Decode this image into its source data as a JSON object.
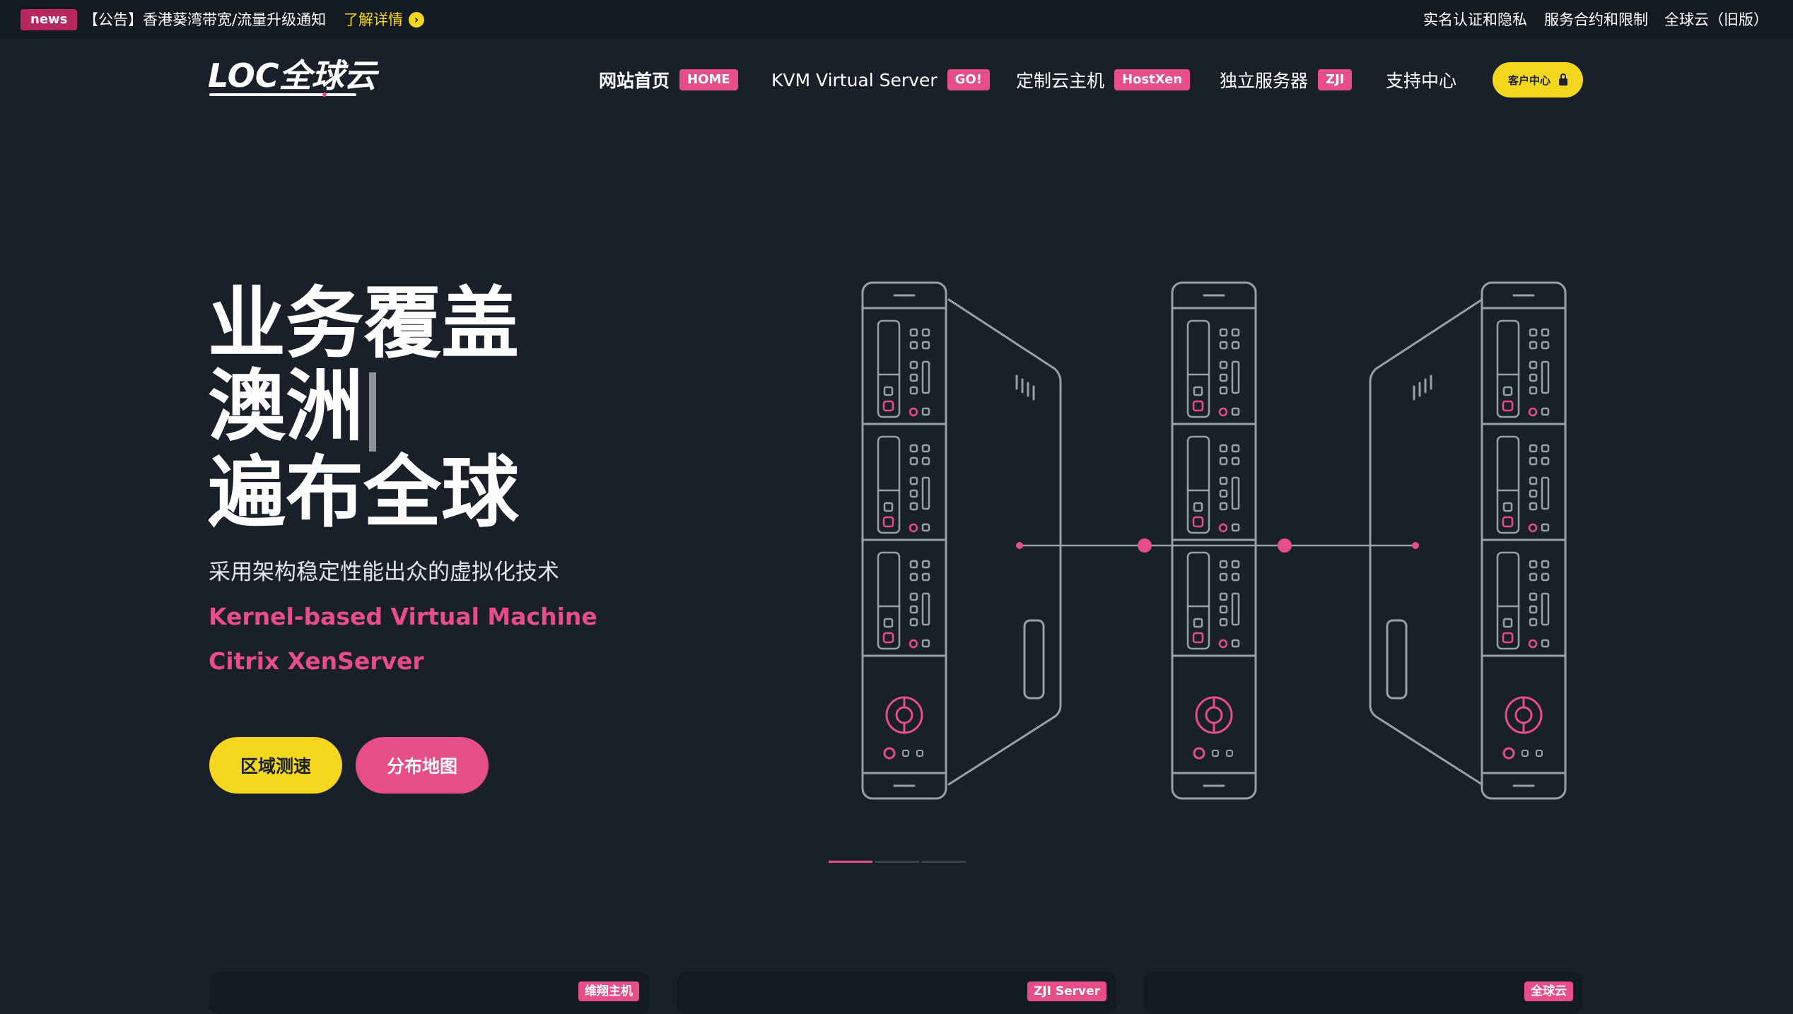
{
  "topbar": {
    "badge": "news",
    "notice": "【公告】香港葵湾带宽/流量升级通知",
    "notice_link": "了解详情",
    "links": [
      "实名认证和隐私",
      "服务合约和限制",
      "全球云（旧版）"
    ]
  },
  "logo": {
    "text": "LOC全球云"
  },
  "nav": {
    "items": [
      {
        "label": "网站首页",
        "tag": "HOME"
      },
      {
        "label": "KVM Virtual Server",
        "tag": "GO!"
      },
      {
        "label": "定制云主机",
        "tag": "HostXen"
      },
      {
        "label": "独立服务器",
        "tag": "ZJI"
      },
      {
        "label": "支持中心"
      }
    ],
    "client_button": "客户中心"
  },
  "hero": {
    "title_line1": "业务覆盖",
    "title_line2": "澳洲",
    "title_line3": "遍布全球",
    "subtitle": "采用架构稳定性能出众的虚拟化技术",
    "tech1": "Kernel-based Virtual Machine",
    "tech2": "Citrix XenServer",
    "button1": "区域测速",
    "button2": "分布地图"
  },
  "slider": {
    "count": 3,
    "active_index": 0
  },
  "cards": [
    {
      "tag": "维翔主机"
    },
    {
      "tag": "ZJI Server"
    },
    {
      "tag": "全球云"
    }
  ],
  "colors": {
    "background": "#19202a",
    "topbar": "#141a22",
    "accent_pink": "#e74d87",
    "accent_yellow": "#f4d61c",
    "illustration_stroke": "#9aa0a8"
  },
  "icons": {
    "notice_arrow": "arrow-right-circle-icon",
    "client_lock": "lock-icon",
    "illustration": "server-rack-illustration"
  }
}
